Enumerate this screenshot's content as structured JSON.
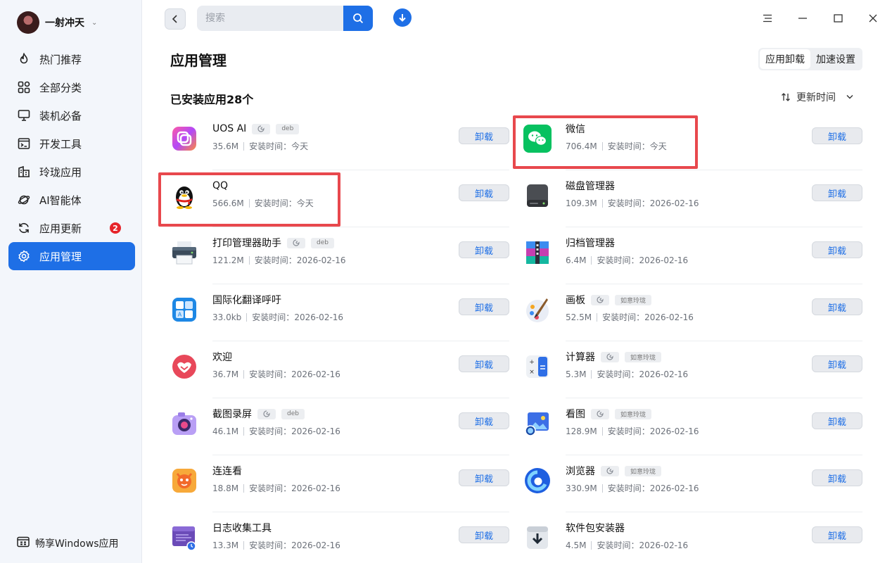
{
  "user": {
    "name": "一射冲天"
  },
  "sidebar": {
    "items": [
      {
        "label": "热门推荐",
        "icon": "flame-icon"
      },
      {
        "label": "全部分类",
        "icon": "grid-icon"
      },
      {
        "label": "装机必备",
        "icon": "monitor-icon"
      },
      {
        "label": "开发工具",
        "icon": "terminal-icon"
      },
      {
        "label": "玲珑应用",
        "icon": "building-icon"
      },
      {
        "label": "AI智能体",
        "icon": "planet-icon"
      },
      {
        "label": "应用更新",
        "icon": "refresh-icon",
        "badge": "2"
      },
      {
        "label": "应用管理",
        "icon": "gear-icon",
        "active": true
      }
    ],
    "windows_link": "畅享Windows应用"
  },
  "search": {
    "placeholder": "搜索"
  },
  "page": {
    "title": "应用管理"
  },
  "segmented": {
    "uninstall": "应用卸载",
    "accel": "加速设置"
  },
  "list": {
    "count_label": "已安装应用28个",
    "sort_label": "更新时间",
    "time_prefix": "安装时间：",
    "uninstall_label": "卸载"
  },
  "apps": [
    {
      "name": "UOS AI",
      "size": "35.6M",
      "time": "今天",
      "tags": [
        "linglong",
        "deb"
      ]
    },
    {
      "name": "微信",
      "size": "706.4M",
      "time": "今天",
      "tags": []
    },
    {
      "name": "QQ",
      "size": "566.6M",
      "time": "今天",
      "tags": []
    },
    {
      "name": "磁盘管理器",
      "size": "109.3M",
      "time": "2026-02-16",
      "tags": []
    },
    {
      "name": "打印管理器助手",
      "size": "121.2M",
      "time": "2026-02-16",
      "tags": [
        "linglong",
        "deb"
      ]
    },
    {
      "name": "归档管理器",
      "size": "6.4M",
      "time": "2026-02-16",
      "tags": []
    },
    {
      "name": "国际化翻译呼吁",
      "size": "33.0kb",
      "time": "2026-02-16",
      "tags": []
    },
    {
      "name": "画板",
      "size": "52.5M",
      "time": "2026-02-16",
      "tags": [
        "linglong",
        "如意玲珑"
      ]
    },
    {
      "name": "欢迎",
      "size": "36.7M",
      "time": "2026-02-16",
      "tags": []
    },
    {
      "name": "计算器",
      "size": "5.3M",
      "time": "2026-02-16",
      "tags": [
        "linglong",
        "如意玲珑"
      ]
    },
    {
      "name": "截图录屏",
      "size": "46.1M",
      "time": "2026-02-16",
      "tags": [
        "linglong",
        "deb"
      ]
    },
    {
      "name": "看图",
      "size": "128.9M",
      "time": "2026-02-16",
      "tags": [
        "linglong",
        "如意玲珑"
      ]
    },
    {
      "name": "连连看",
      "size": "18.8M",
      "time": "2026-02-16",
      "tags": []
    },
    {
      "name": "浏览器",
      "size": "330.9M",
      "time": "2026-02-16",
      "tags": [
        "linglong",
        "如意玲珑"
      ]
    },
    {
      "name": "日志收集工具",
      "size": "13.3M",
      "time": "2026-02-16",
      "tags": []
    },
    {
      "name": "软件包安装器",
      "size": "4.5M",
      "time": "2026-02-16",
      "tags": []
    }
  ],
  "colors": {
    "accent": "#1e6fe6",
    "highlight": "#e8484d",
    "badge": "#e6242a"
  }
}
